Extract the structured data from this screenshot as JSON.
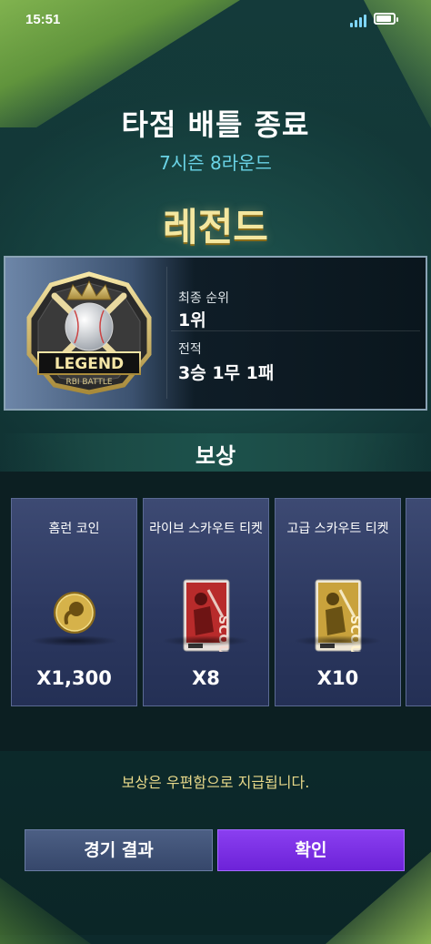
{
  "status_bar": {
    "time": "15:51"
  },
  "header": {
    "title": "타점 배틀 종료",
    "subtitle": "7시즌 8라운드",
    "tier": "레전드"
  },
  "badge": {
    "main_text": "LEGEND",
    "sub_text": "RBI BATTLE"
  },
  "result": {
    "rank_label": "최종 순위",
    "rank_value": "1위",
    "record_label": "전적",
    "record_value": "3승 1무 1패"
  },
  "rewards": {
    "title": "보상",
    "items": [
      {
        "name": "홈런 코인",
        "quantity": "X1,300",
        "icon": "coin-icon"
      },
      {
        "name": "라이브 스카우트 티켓",
        "quantity": "X8",
        "icon": "live-scout-ticket-icon"
      },
      {
        "name": "고급 스카우트 티켓",
        "quantity": "X10",
        "icon": "premium-scout-ticket-icon"
      }
    ]
  },
  "notice": "보상은 우편함으로 지급됩니다.",
  "buttons": {
    "result": "경기 결과",
    "confirm": "확인"
  },
  "colors": {
    "accent_purple": "#7b2ff0",
    "tier_gold": "#f4e7a0",
    "subtitle_cyan": "#6ad3e6"
  }
}
